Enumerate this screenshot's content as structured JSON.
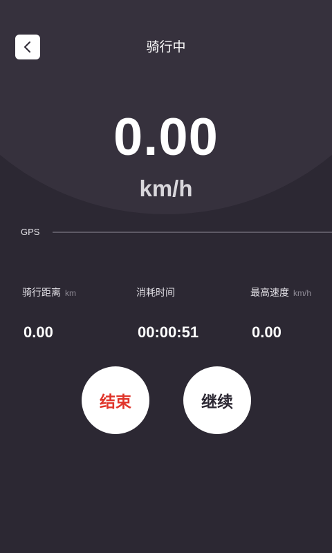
{
  "header": {
    "title": "骑行中",
    "back_icon": "chevron-left-icon"
  },
  "speed": {
    "value": "0.00",
    "unit": "km/h"
  },
  "gps": {
    "label": "GPS"
  },
  "stats": {
    "distance": {
      "label": "骑行距离",
      "unit": "km",
      "value": "0.00"
    },
    "time": {
      "label": "消耗时间",
      "value": "00:00:51"
    },
    "max_speed": {
      "label": "最高速度",
      "unit": "km/h",
      "value": "0.00"
    }
  },
  "actions": {
    "end_label": "结束",
    "continue_label": "继续"
  },
  "colors": {
    "background": "#2c2833",
    "panel": "#36313d",
    "end_text": "#e0342a"
  }
}
